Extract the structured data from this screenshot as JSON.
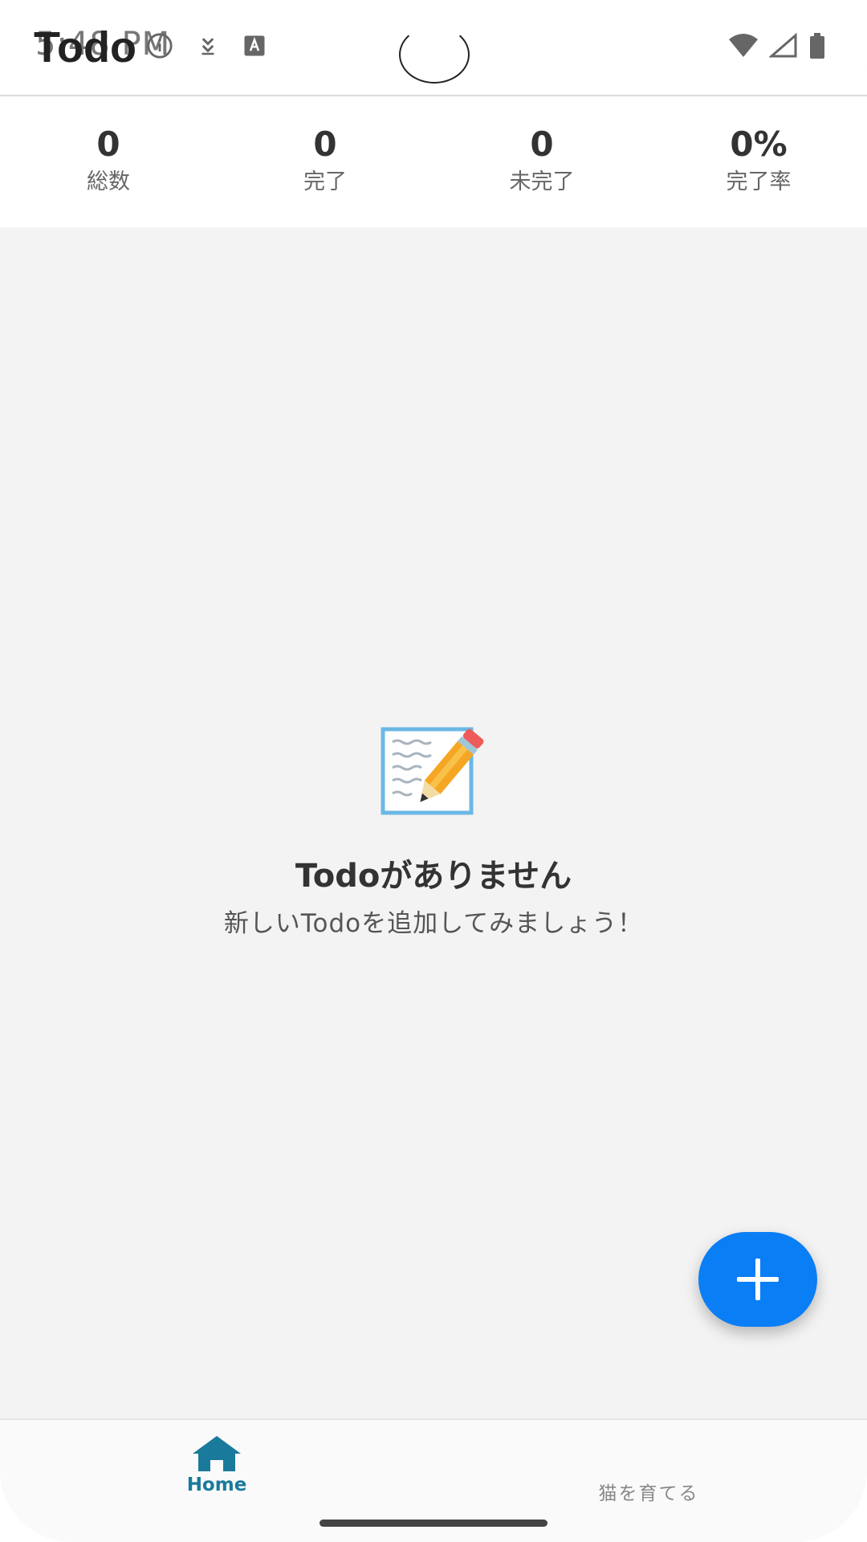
{
  "status_bar": {
    "time": "5:48 PM",
    "icons_left": [
      "info-icon",
      "download-icon",
      "font-icon"
    ],
    "icons_right": [
      "wifi-icon",
      "signal-icon",
      "battery-icon"
    ]
  },
  "header": {
    "title": "Todo"
  },
  "stats": [
    {
      "value": "0",
      "label": "総数"
    },
    {
      "value": "0",
      "label": "完了"
    },
    {
      "value": "0",
      "label": "未完了"
    },
    {
      "value": "0%",
      "label": "完了率"
    }
  ],
  "empty_state": {
    "icon": "memo-pencil-icon",
    "title": "Todoがありません",
    "subtitle": "新しいTodoを追加してみましょう！"
  },
  "fab": {
    "icon": "plus-icon"
  },
  "bottom_nav": {
    "items": [
      {
        "label": "Home",
        "icon": "home-icon",
        "active": true
      },
      {
        "label": "猫を育てる",
        "active": false
      }
    ]
  },
  "colors": {
    "accent": "#0a7ef5",
    "nav_active": "#1a7a9c",
    "background": "#f3f3f3"
  }
}
